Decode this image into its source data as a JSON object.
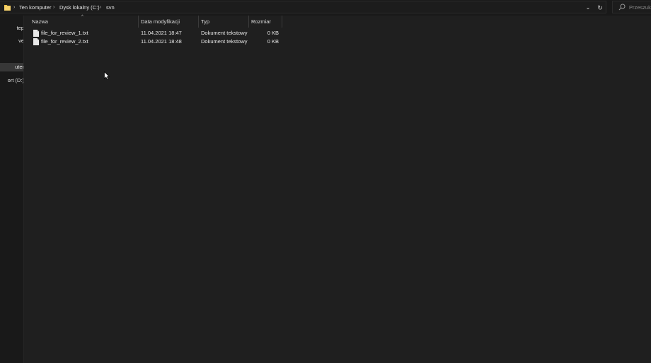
{
  "breadcrumb": {
    "items": [
      "Ten komputer",
      "Dysk lokalny (C:)",
      "svn"
    ],
    "separator": "›"
  },
  "addressbar": {
    "dropdown_glyph": "⌄",
    "refresh_glyph": "↻"
  },
  "search": {
    "placeholder": "Przeszuka"
  },
  "navpane": {
    "items": [
      {
        "label": "tep",
        "selected": false
      },
      {
        "label": "ve",
        "selected": false
      },
      {
        "label": "uter",
        "selected": true
      },
      {
        "label": "ort (D:)",
        "selected": false
      }
    ]
  },
  "columns": {
    "name": "Nazwa",
    "date": "Data modyfikacji",
    "type": "Typ",
    "size": "Rozmiar",
    "sort_glyph": "^"
  },
  "files": [
    {
      "name": "file_for_review_1.txt",
      "date": "11.04.2021 18:47",
      "type": "Dokument tekstowy",
      "size": "0 KB"
    },
    {
      "name": "file_for_review_2.txt",
      "date": "11.04.2021 18:48",
      "type": "Dokument tekstowy",
      "size": "0 KB"
    }
  ],
  "colors": {
    "folder_icon": "#f4c74f",
    "background": "#191919",
    "content_background": "#1f1f1f",
    "selected_nav": "#373737"
  },
  "icons": {
    "folder": "folder-icon",
    "file": "text-file-icon",
    "search": "search-icon",
    "refresh": "refresh-icon",
    "dropdown": "chevron-down-icon"
  }
}
